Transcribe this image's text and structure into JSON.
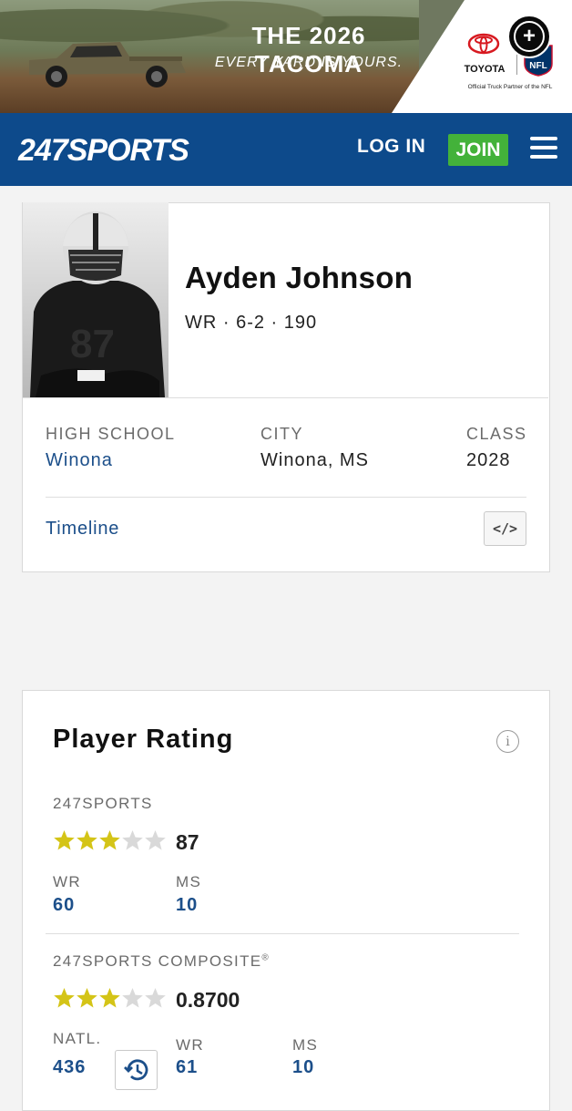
{
  "ad": {
    "headline": "THE 2026 TACOMA",
    "tagline": "EVERY YARD IS YOURS.",
    "brand": "TOYOTA",
    "partner": "Official Truck Partner of the NFL",
    "nfl_text": "NFL"
  },
  "header": {
    "logo_text": "247SPORTS",
    "login_label": "LOG IN",
    "join_label": "JOIN",
    "brand_color": "#0d4a8b",
    "join_color": "#43b23a"
  },
  "player": {
    "name": "Ayden Johnson",
    "meta": "WR · 6-2 · 190",
    "high_school_label": "HIGH SCHOOL",
    "high_school": "Winona",
    "city_label": "CITY",
    "city": "Winona, MS",
    "class_label": "CLASS",
    "class": "2028",
    "timeline_label": "Timeline",
    "embed_label": "</>",
    "jersey_number": "87"
  },
  "rating": {
    "title": "Player Rating",
    "info_label": "i",
    "sports247": {
      "label": "247SPORTS",
      "stars": 3,
      "max_stars": 5,
      "score": "87",
      "position_label": "WR",
      "position_rank": "60",
      "state_label": "MS",
      "state_rank": "10"
    },
    "composite": {
      "label": "247SPORTS COMPOSITE",
      "registered": "®",
      "stars": 3,
      "max_stars": 5,
      "score": "0.8700",
      "national_label": "NATL.",
      "national_rank": "436",
      "position_label": "WR",
      "position_rank": "61",
      "state_label": "MS",
      "state_rank": "10"
    },
    "star_color": "#d4c417",
    "star_empty_color": "#d9d9d9"
  }
}
